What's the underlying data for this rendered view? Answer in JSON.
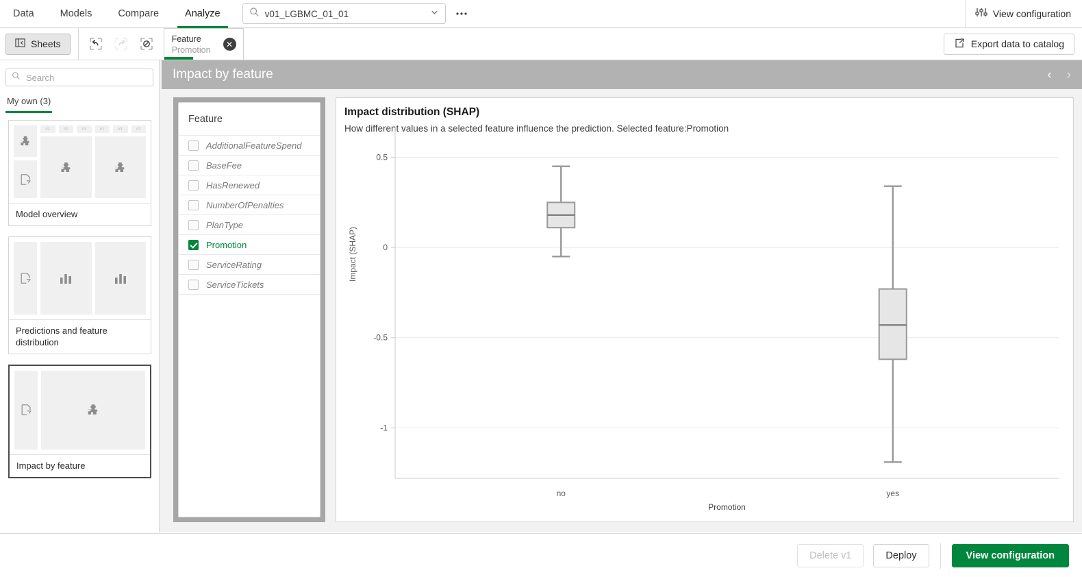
{
  "topnav": {
    "tabs": [
      {
        "label": "Data",
        "active": false
      },
      {
        "label": "Models",
        "active": false
      },
      {
        "label": "Compare",
        "active": false
      },
      {
        "label": "Analyze",
        "active": true
      }
    ],
    "search_value": "v01_LGBMC_01_01",
    "more_label": "•••",
    "view_configuration_label": "View configuration"
  },
  "toolbar": {
    "sheets_label": "Sheets",
    "selection_chip": {
      "title": "Feature",
      "value": "Promotion",
      "close_label": "✕"
    },
    "export_label": "Export data to catalog"
  },
  "sidebar": {
    "search_placeholder": "Search",
    "tab_label": "My own (3)",
    "cards": [
      {
        "title": "Model overview",
        "selected": false
      },
      {
        "title": "Predictions and feature distribution",
        "selected": false
      },
      {
        "title": "Impact by feature",
        "selected": true
      }
    ],
    "minibar_label": "#1"
  },
  "sheet": {
    "title": "Impact by feature",
    "prev_label": "‹",
    "next_label": "›"
  },
  "feature_panel": {
    "title": "Feature",
    "items": [
      {
        "label": "AdditionalFeatureSpend",
        "selected": false
      },
      {
        "label": "BaseFee",
        "selected": false
      },
      {
        "label": "HasRenewed",
        "selected": false
      },
      {
        "label": "NumberOfPenalties",
        "selected": false
      },
      {
        "label": "PlanType",
        "selected": false
      },
      {
        "label": "Promotion",
        "selected": true
      },
      {
        "label": "ServiceRating",
        "selected": false
      },
      {
        "label": "ServiceTickets",
        "selected": false
      }
    ]
  },
  "chart_panel": {
    "title": "Impact distribution (SHAP)",
    "subtitle": "How different values in a selected feature influence the prediction. Selected feature:Promotion"
  },
  "chart_data": {
    "type": "box",
    "title": "Impact distribution (SHAP)",
    "subtitle": "How different values in a selected feature influence the prediction. Selected feature:Promotion",
    "xlabel": "Promotion",
    "ylabel": "Impact (SHAP)",
    "categories": [
      "no",
      "yes"
    ],
    "ytick_labels": [
      "0.5",
      "0",
      "-0.5",
      "-1"
    ],
    "ytick_values": [
      0.5,
      0,
      -0.5,
      -1
    ],
    "ylim": [
      -1.28,
      0.62
    ],
    "grid": true,
    "legend": "none",
    "boxes": [
      {
        "category": "no",
        "whisker_low": -0.05,
        "q1": 0.11,
        "median": 0.18,
        "q3": 0.25,
        "whisker_high": 0.45
      },
      {
        "category": "yes",
        "whisker_low": -1.19,
        "q1": -0.62,
        "median": -0.43,
        "q3": -0.23,
        "whisker_high": 0.34
      }
    ]
  },
  "bottombar": {
    "delete_label": "Delete v1",
    "deploy_label": "Deploy",
    "view_configuration_label": "View configuration"
  },
  "colors": {
    "accent_green": "#00873d",
    "header_gray": "#b2b2b2",
    "box_fill": "#e6e6e6",
    "box_stroke": "#999999"
  }
}
